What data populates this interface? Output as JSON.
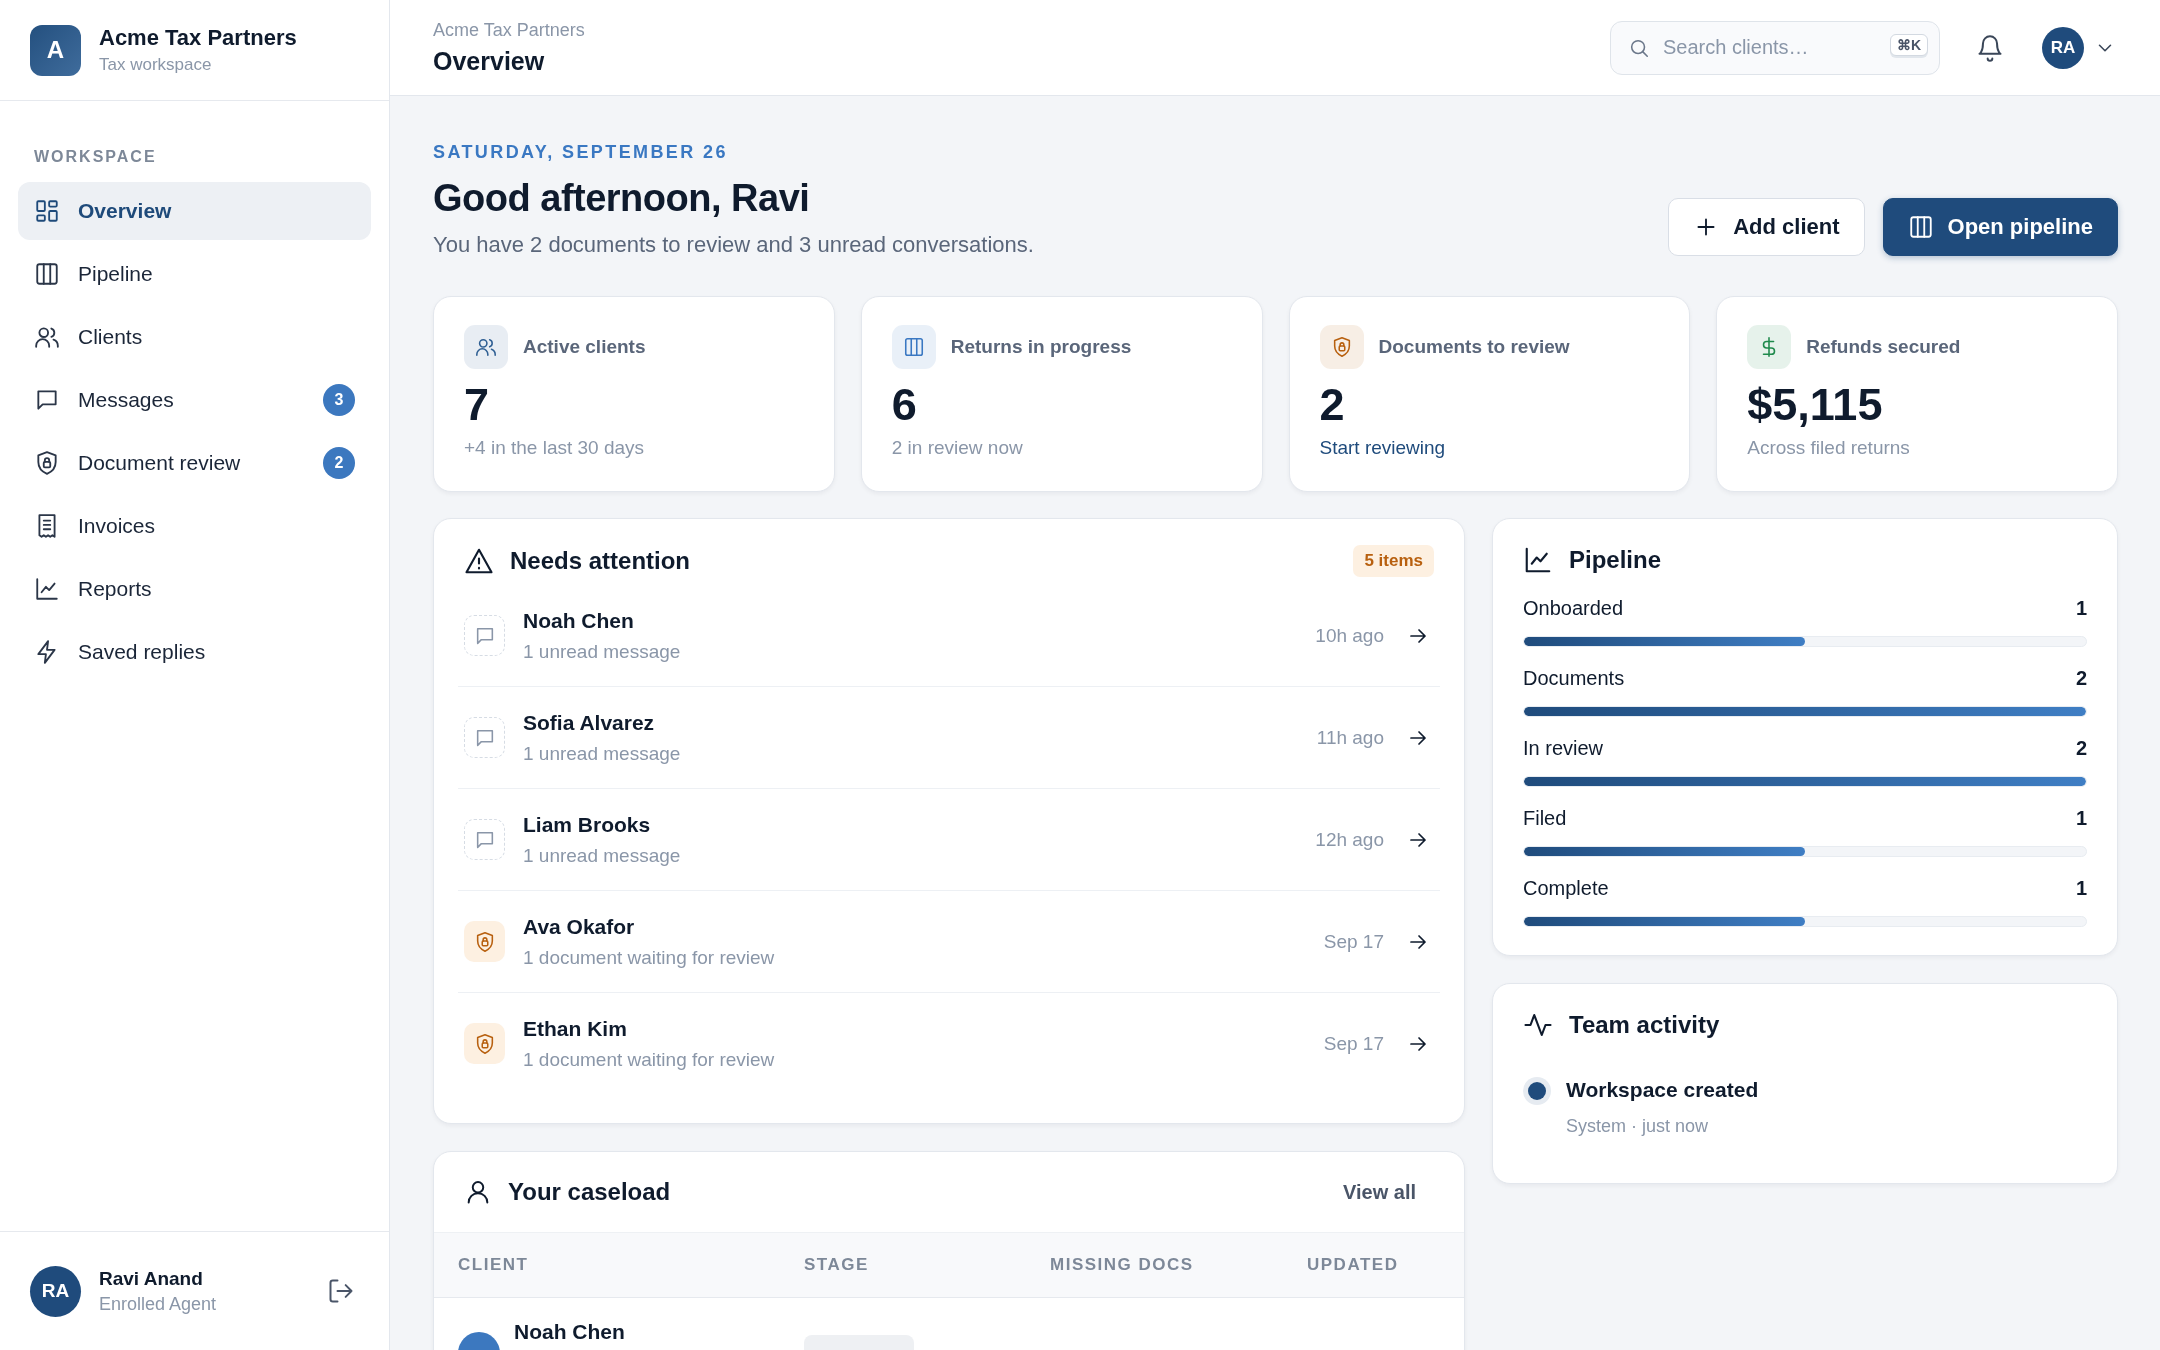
{
  "brand": {
    "initial": "A",
    "name": "Acme Tax Partners",
    "subtitle": "Tax workspace"
  },
  "sidebar": {
    "section": "WORKSPACE",
    "items": [
      {
        "label": "Overview",
        "selected": true
      },
      {
        "label": "Pipeline",
        "selected": false
      },
      {
        "label": "Clients",
        "selected": false
      },
      {
        "label": "Messages",
        "selected": false,
        "badge": "3"
      },
      {
        "label": "Document review",
        "selected": false,
        "badge": "2"
      },
      {
        "label": "Invoices",
        "selected": false
      },
      {
        "label": "Reports",
        "selected": false
      },
      {
        "label": "Saved replies",
        "selected": false
      }
    ]
  },
  "user": {
    "initials": "RA",
    "name": "Ravi Anand",
    "role": "Enrolled Agent"
  },
  "header": {
    "breadcrumb": "Acme Tax Partners",
    "title": "Overview",
    "search": {
      "placeholder": "Search clients…",
      "shortcut": "⌘K"
    },
    "avatar": "RA"
  },
  "greeting": {
    "date": "SATURDAY, SEPTEMBER 26",
    "title": "Good afternoon, Ravi",
    "subtitle": "You have 2 documents to review and 3 unread conversations.",
    "buttons": [
      {
        "label": "Add client",
        "kind": "secondary"
      },
      {
        "label": "Open pipeline",
        "kind": "primary"
      }
    ]
  },
  "stats": [
    {
      "label": "Active clients",
      "value": "7",
      "note": "+4 in the last 30 days",
      "kind": "plain",
      "color": "#2f5f93"
    },
    {
      "label": "Returns in progress",
      "value": "6",
      "note": "2 in review now",
      "kind": "plain",
      "color": "#3a78c2"
    },
    {
      "label": "Documents to review",
      "value": "2",
      "note": "Start reviewing",
      "kind": "link",
      "color": "#b8600f"
    },
    {
      "label": "Refunds secured",
      "value": "$5,115",
      "note": "Across filed returns",
      "kind": "plain",
      "color": "#1f8a4c"
    }
  ],
  "attention": {
    "title": "Needs attention",
    "count": "5 items",
    "items": [
      {
        "name": "Noah Chen",
        "detail": "1 unread message",
        "time": "10h ago",
        "kind": "message"
      },
      {
        "name": "Sofia Alvarez",
        "detail": "1 unread message",
        "time": "11h ago",
        "kind": "message"
      },
      {
        "name": "Liam Brooks",
        "detail": "1 unread message",
        "time": "12h ago",
        "kind": "message"
      },
      {
        "name": "Ava Okafor",
        "detail": "1 document waiting for review",
        "time": "Sep 17",
        "kind": "document"
      },
      {
        "name": "Ethan Kim",
        "detail": "1 document waiting for review",
        "time": "Sep 17",
        "kind": "document"
      }
    ]
  },
  "pipeline": {
    "title": "Pipeline",
    "stages": [
      {
        "label": "Onboarded",
        "count": "1",
        "level": 0.5
      },
      {
        "label": "Documents",
        "count": "2",
        "level": 1
      },
      {
        "label": "In review",
        "count": "2",
        "level": 1
      },
      {
        "label": "Filed",
        "count": "1",
        "level": 0.5
      },
      {
        "label": "Complete",
        "count": "1",
        "level": 0.5
      }
    ]
  },
  "activity": {
    "title": "Team activity",
    "events": [
      {
        "title": "Workspace created",
        "meta": "System · just now"
      }
    ]
  },
  "caseload": {
    "title": "Your caseload",
    "link": "View all",
    "columns": [
      "CLIENT",
      "STAGE",
      "MISSING DOCS",
      "UPDATED"
    ],
    "rows": [
      {
        "client": "Noah Chen"
      }
    ]
  }
}
